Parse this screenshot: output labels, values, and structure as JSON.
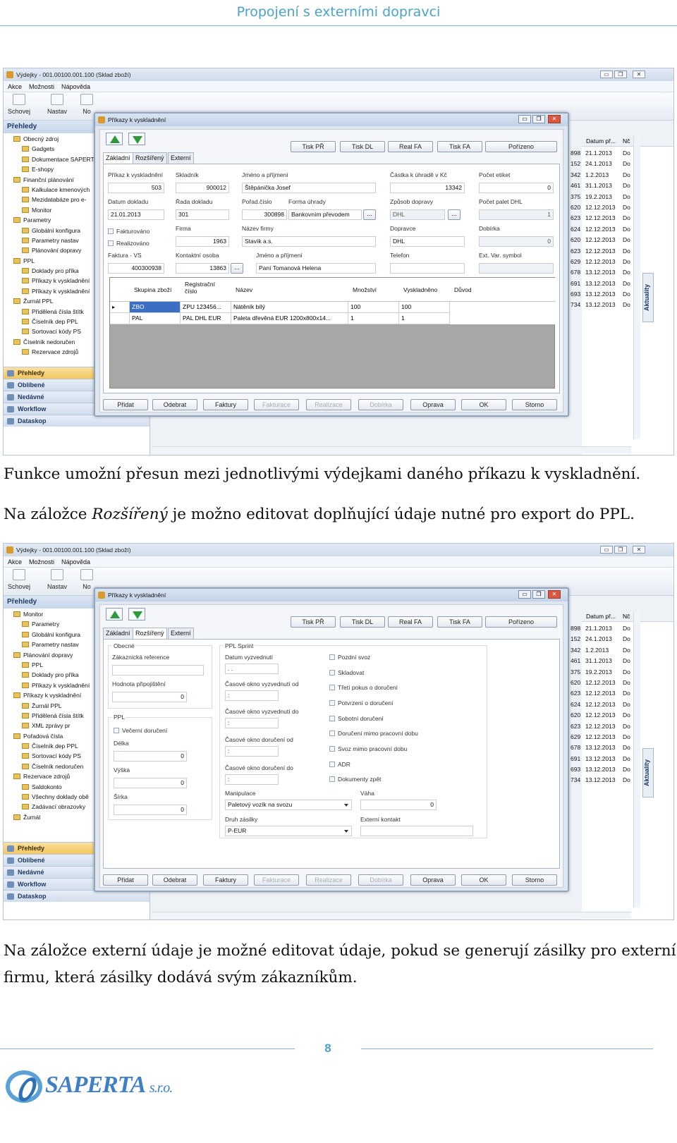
{
  "header": {
    "title": "Propojení s externími dopravci"
  },
  "paragraphs": {
    "p1": "Funkce umožní přesun mezi jednotlivými výdejkami daného příkazu k vyskladnění.",
    "p2_before": "Na záložce ",
    "p2_em": "Rozšířený",
    "p2_after": " je možno editovat doplňující údaje nutné pro export do PPL.",
    "p3_line1": "Na záložce externí údaje je možné editovat údaje, pokud se generují zásilky pro externí",
    "p3_line2": "firmu, která zásilky dodává svým zákazníkům."
  },
  "footer": {
    "page_number": "8",
    "logo_text": "SAPERTA",
    "logo_suffix": "s.r.o."
  },
  "app": {
    "window_title": "Výdejky - 001.00100.001.100 (Sklad zboží)",
    "window_buttons": [
      "▭",
      "❐",
      "✕"
    ],
    "menu": [
      "Akce",
      "Možnosti",
      "Nápověda"
    ],
    "toolbar": [
      "Schovej",
      "Nastav",
      "No"
    ],
    "left_header": "Přehledy",
    "nav": [
      "Přehledy",
      "Oblíbené",
      "Nedávné",
      "Workflow",
      "Dataskop"
    ],
    "right_header": [
      "Datum př...",
      "Nč"
    ],
    "right_num": [
      "898",
      "152",
      "342",
      "461",
      "375",
      "620",
      "623",
      "624",
      "620",
      "623",
      "629",
      "678",
      "691",
      "693",
      "734"
    ],
    "right_dates": [
      "21.1.2013",
      "24.1.2013",
      "1.2.2013",
      "31.1.2013",
      "19.2.2013",
      "12.12.2013",
      "12.12.2013",
      "12.12.2013",
      "12.12.2013",
      "12.12.2013",
      "12.12.2013",
      "13.12.2013",
      "13.12.2013",
      "13.12.2013",
      "13.12.2013"
    ],
    "right_do": "Do",
    "side_tab": "Aktuality"
  },
  "dialog": {
    "title": "Příkazy k vyskladnění",
    "title_buttons": [
      "▭",
      "❐",
      "✕"
    ],
    "top_buttons": [
      "Tisk PŘ",
      "Tisk DL",
      "Real FA",
      "Tisk FA",
      "Pořízeno"
    ],
    "tabs": [
      "Základní",
      "Rozšířený",
      "Externí údaje"
    ],
    "bottom_buttons": [
      "Přidat",
      "Odebrat",
      "Faktury",
      "Fakturace",
      "Realizace",
      "Dobírka",
      "Oprava",
      "OK",
      "Storno"
    ]
  },
  "basic": {
    "l_prikaz": "Příkaz k vyskladnění",
    "v_prikaz": "503",
    "l_skladnik": "Skladník",
    "v_skladnik": "900012",
    "l_jmeno": "Jméno a příjmení",
    "v_jmeno": "Štěpánička Josef",
    "l_castka": "Částka k úhradě v Kč",
    "v_castka": "13342",
    "l_etiket": "Počet etiket",
    "v_etiket": "0",
    "l_datum": "Datum dokladu",
    "v_datum": "21.01.2013",
    "l_rada": "Řada dokladu",
    "v_rada": "301",
    "l_porad": "Pořad.číslo",
    "v_porad": "300898",
    "l_forma": "Forma úhrady",
    "v_forma": "Bankovním převodem",
    "l_zpusob": "Způsob dopravy",
    "v_zpusob": "DHL",
    "l_palet": "Počet palet DHL",
    "v_palet": "1",
    "c_fakt": "Fakturováno",
    "c_real": "Realizováno",
    "l_firma": "Firma",
    "v_firma": "1963",
    "l_nazev": "Název firmy",
    "v_nazev": "Stavík a.s.",
    "l_dopravce": "Dopravce",
    "v_dopravce": "DHL",
    "l_dobirka": "Dobírka",
    "v_dobirka": "0",
    "l_faktura": "Faktura - VS",
    "v_faktura": "400300938",
    "l_kontakt": "Kontaktní osoba",
    "v_kontakt": "13863",
    "l_jmeno2": "Jméno a příjmení",
    "v_jmeno2": "Paní Tomanová Helena",
    "l_telefon": "Telefon",
    "l_ext": "Ext. Var. symbol",
    "ellipsis": "...",
    "grid_headers": [
      "Skupina zboží",
      "Registrační číslo",
      "Název",
      "Množství",
      "Vyskladněno",
      "Důvod"
    ],
    "grid_rows": [
      [
        "ZBO",
        "ZPU 123456...",
        "Nátěník bílý",
        "100",
        "100"
      ],
      [
        "PAL",
        "PAL DHL EUR",
        "Paleta dřevěná EUR 1200x800x14...",
        "1",
        "1"
      ]
    ],
    "row_marker": "▸"
  },
  "ext": {
    "g_obecne": "Obecné",
    "l_zak": "Zákaznická reference",
    "l_hodnota": "Hodnota připojištění",
    "v_hodnota": "0",
    "g_ppl": "PPL",
    "c_vecerni": "Večerní doručení",
    "l_delka": "Délka",
    "v_delka": "0",
    "l_vyska": "Výška",
    "v_vyska": "0",
    "l_sirka": "Šírka",
    "v_sirka": "0",
    "g_sprint": "PPL Sprint",
    "l_datum_vyz": "Datum vyzvednutí",
    "v_datum_vyz": ". .",
    "l_od1": "Časové okno vyzvednutí od",
    "v_od1": ":",
    "l_do1": "Časové okno vyzvednutí do",
    "v_do1": ":",
    "l_od2": "Časové okno doručení od",
    "v_od2": ":",
    "l_do2": "Časové okno doručení do",
    "v_do2": ":",
    "l_manip": "Manipulace",
    "v_manip": "Paletový vozík na svozu",
    "l_druh": "Druh zásilky",
    "v_druh": "P-EUR",
    "l_vaha": "Váha",
    "v_vaha": "0",
    "l_extk": "Externí kontakt",
    "checks": [
      "Pozdní svoz",
      "Skladovat",
      "Třetí pokus o doručení",
      "Potvrzení o doručení",
      "Sobotní doručení",
      "Doručení mimo pracovní dobu",
      "Svoz mimo pracovní dobu",
      "ADR",
      "Dokumenty zpět"
    ]
  },
  "tree1": [
    "Obecný zdroj",
    "Gadgets",
    "Dokumentace SAPERTA",
    "E-shopy",
    "Finanční plánování",
    "Kalkulace kmenových",
    "Mezidatabáze pro e-",
    "Monitor",
    "Parametry",
    "Globální konfigura",
    "Parametry nastav",
    "Plánování dopravy",
    "PPL",
    "Doklady pro příka",
    "Příkazy k vyskladnění",
    "Příkazy k vyskladnění",
    "Žurnál PPL",
    "Přidělená čísla štítk",
    "Číselník dep PPL",
    "Sortovací kódy PS",
    "Číselník nedoručen",
    "Rezervace zdrojů"
  ],
  "tree2": [
    "Monitor",
    "Parametry",
    "Globální konfigura",
    "Parametry nastav",
    "Plánování dopravy",
    "PPL",
    "Doklady pro příka",
    "Příkazy k vyskladnění",
    "Příkazy k vyskladnění",
    "Žurnál PPL",
    "Přidělená čísla štítk",
    "XML zprávy pr",
    "Pořadová čísla",
    "Číselník dep PPL",
    "Sortovací kódy PS",
    "Číselník nedoručen",
    "Rezervace zdrojů",
    "Saldokonto",
    "Všechny doklady obě",
    "Zadávací obrazovky",
    "Žurnál"
  ]
}
